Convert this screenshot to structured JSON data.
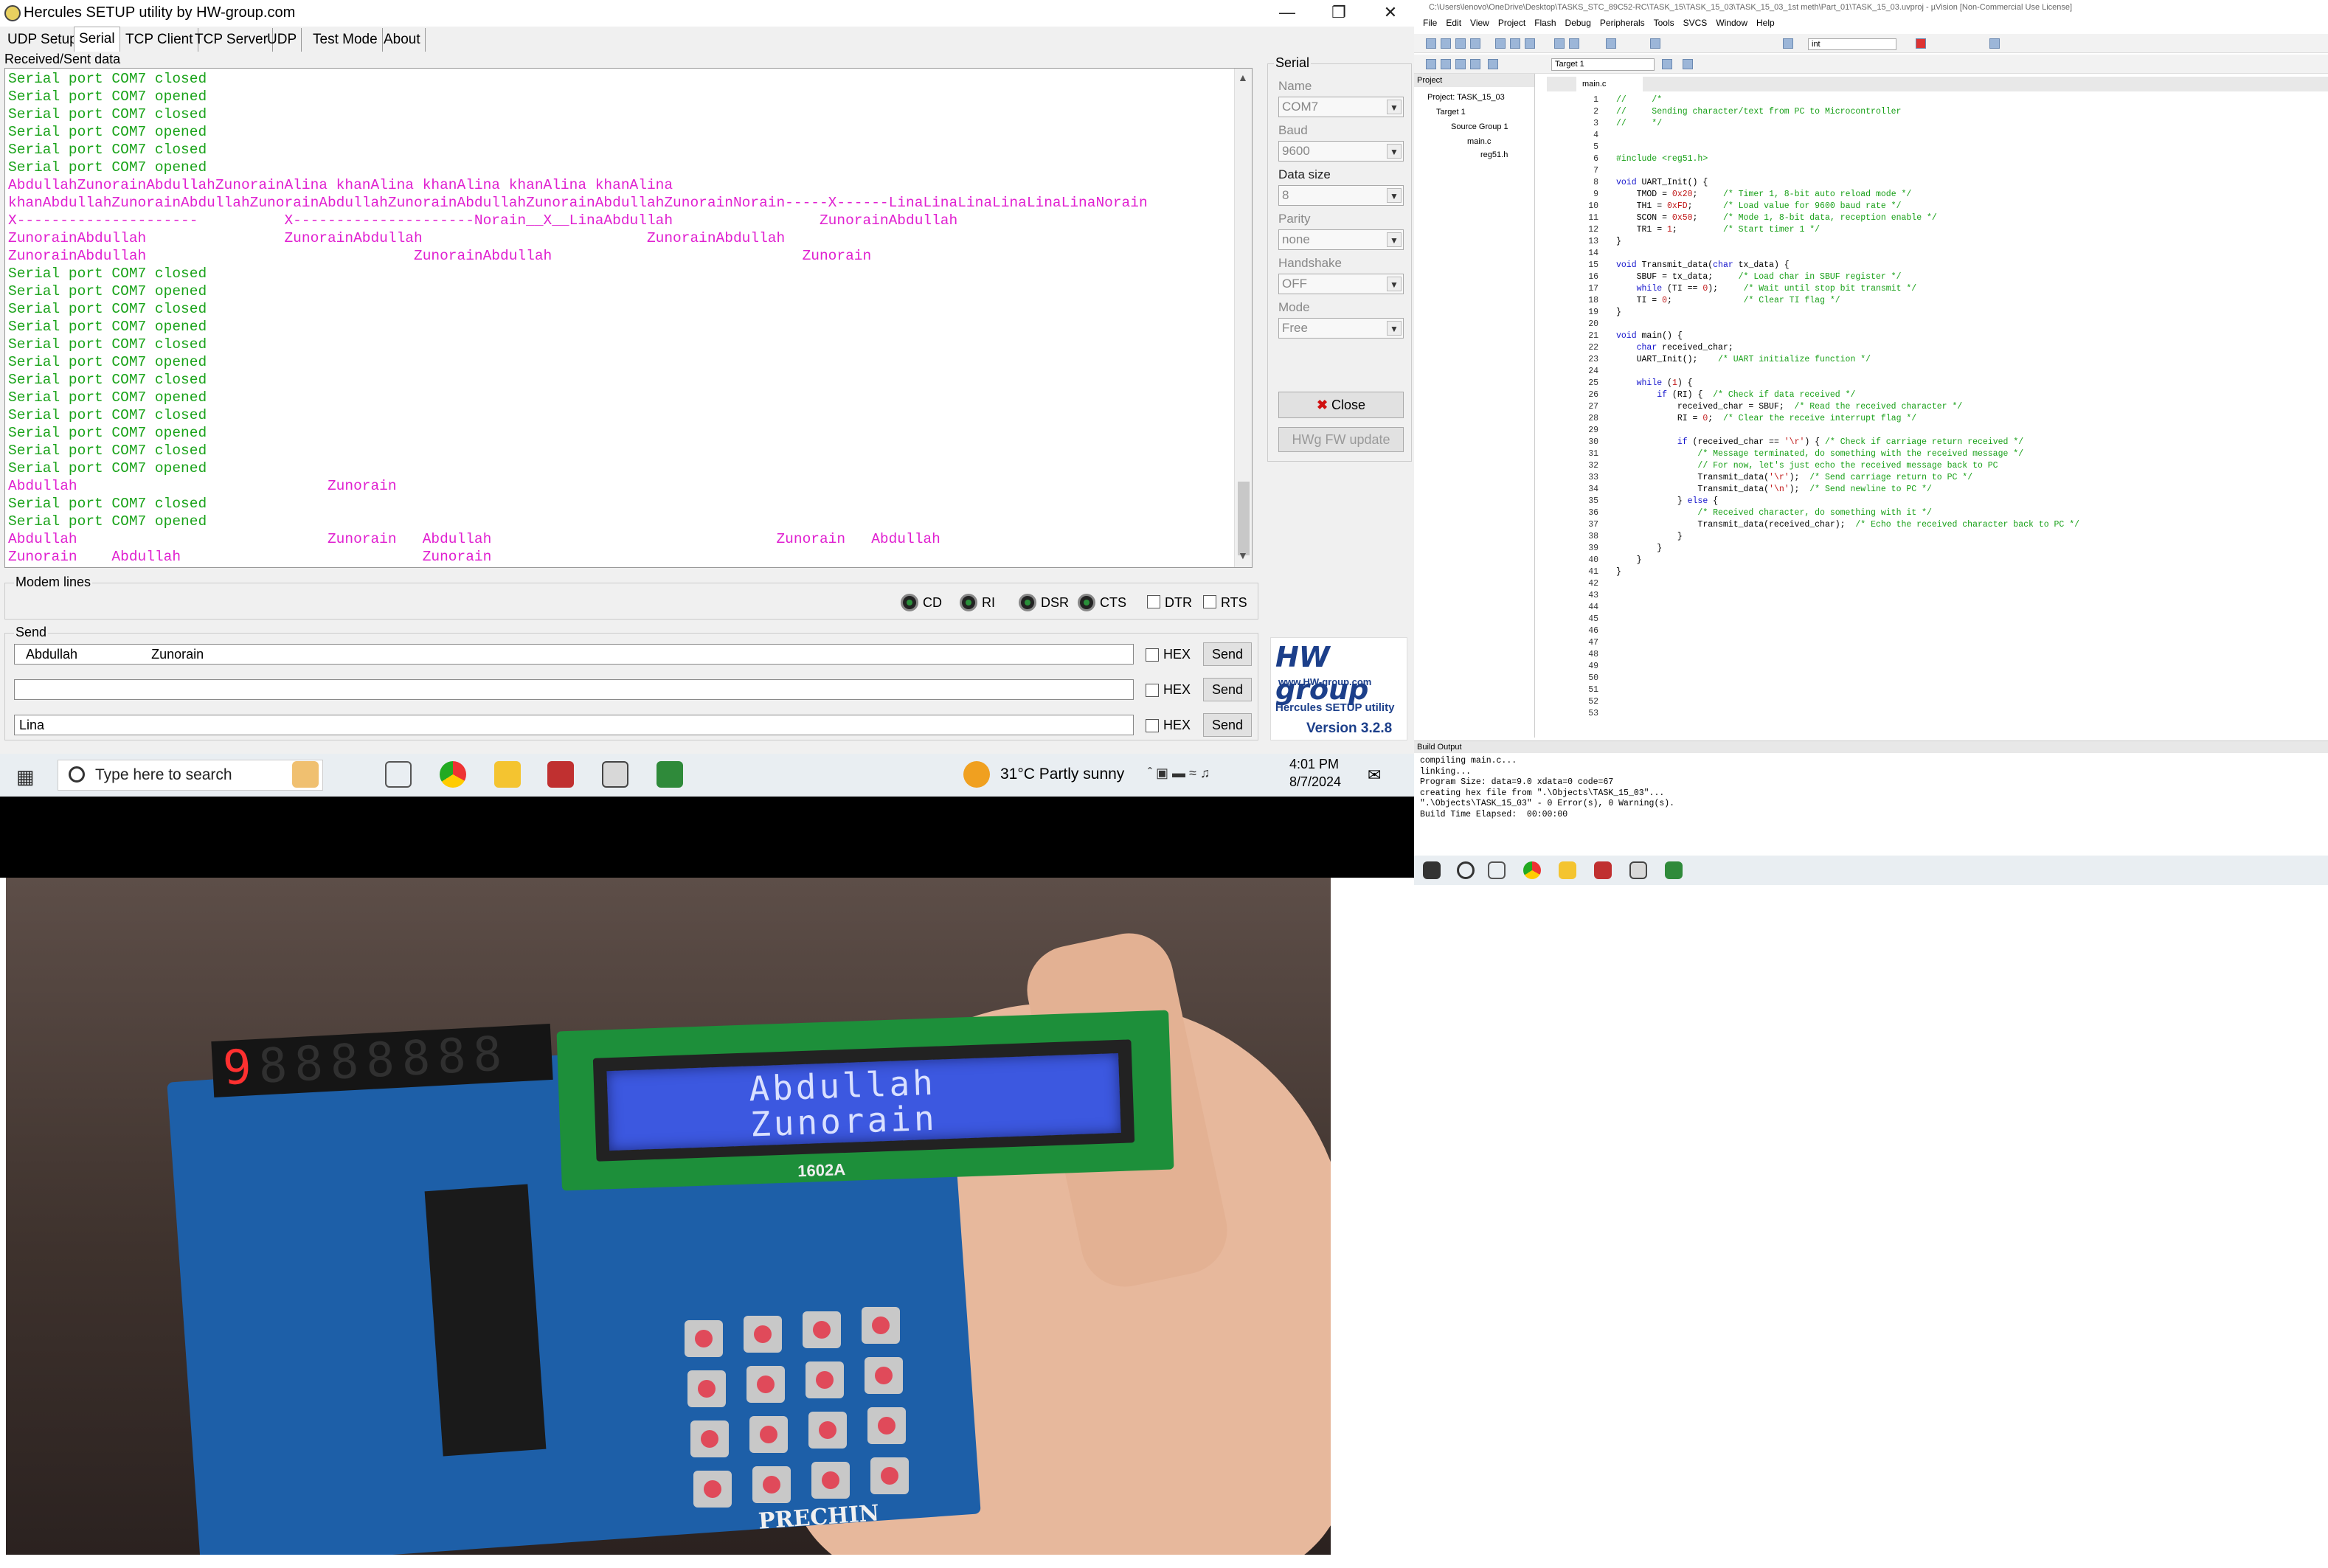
{
  "hercules": {
    "title": "Hercules SETUP utility by HW-group.com",
    "tabs": [
      "UDP Setup",
      "Serial",
      "TCP Client",
      "TCP Server",
      "UDP",
      "Test Mode",
      "About"
    ],
    "received_label": "Received/Sent data",
    "terminal": [
      {
        "t": "Serial port COM7 closed",
        "c": "g"
      },
      {
        "t": "Serial port COM7 opened",
        "c": "g"
      },
      {
        "t": "Serial port COM7 closed",
        "c": "g"
      },
      {
        "t": "Serial port COM7 opened",
        "c": "g"
      },
      {
        "t": "Serial port COM7 closed",
        "c": "g"
      },
      {
        "t": "Serial port COM7 opened",
        "c": "g"
      },
      {
        "t": "AbdullahZunorainAbdullahZunorainAlina khanAlina khanAlina khanAlina khanAlina",
        "c": "m"
      },
      {
        "t": "khanAbdullahZunorainAbdullahZunorainAbdullahZunorainAbdullahZunorainAbdullahZunorainNorain-----X------LinaLinaLinaLinaLinaLinaNorain",
        "c": "m"
      },
      {
        "t": "X---------------------          X---------------------Norain__X__LinaAbdullah                 ZunorainAbdullah",
        "c": "m"
      },
      {
        "t": "ZunorainAbdullah                ZunorainAbdullah                          ZunorainAbdullah",
        "c": "m"
      },
      {
        "t": "ZunorainAbdullah                               ZunorainAbdullah                             Zunorain",
        "c": "m"
      },
      {
        "t": "Serial port COM7 closed",
        "c": "g"
      },
      {
        "t": "Serial port COM7 opened",
        "c": "g"
      },
      {
        "t": "Serial port COM7 closed",
        "c": "g"
      },
      {
        "t": "Serial port COM7 opened",
        "c": "g"
      },
      {
        "t": "Serial port COM7 closed",
        "c": "g"
      },
      {
        "t": "Serial port COM7 opened",
        "c": "g"
      },
      {
        "t": "Serial port COM7 closed",
        "c": "g"
      },
      {
        "t": "Serial port COM7 opened",
        "c": "g"
      },
      {
        "t": "Serial port COM7 closed",
        "c": "g"
      },
      {
        "t": "Serial port COM7 opened",
        "c": "g"
      },
      {
        "t": "Serial port COM7 closed",
        "c": "g"
      },
      {
        "t": "Serial port COM7 opened",
        "c": "g"
      },
      {
        "t": "Abdullah                             Zunorain",
        "c": "m"
      },
      {
        "t": "Serial port COM7 closed",
        "c": "g"
      },
      {
        "t": "Serial port COM7 opened",
        "c": "g"
      },
      {
        "t": "Abdullah                             Zunorain   Abdullah                                 Zunorain   Abdullah",
        "c": "m"
      },
      {
        "t": "Zunorain    Abdullah                            Zunorain",
        "c": "m"
      }
    ],
    "serial_group": "Serial",
    "fields": [
      {
        "label": "Name",
        "value": "COM7"
      },
      {
        "label": "Baud",
        "value": "9600"
      },
      {
        "label": "Data size",
        "value": "8"
      },
      {
        "label": "Parity",
        "value": "none"
      },
      {
        "label": "Handshake",
        "value": "OFF"
      },
      {
        "label": "Mode",
        "value": "Free"
      }
    ],
    "close_button": "Close",
    "hwg_button": "HWg FW update",
    "modem_label": "Modem lines",
    "leds": [
      "CD",
      "RI",
      "DSR",
      "CTS"
    ],
    "checks": [
      "DTR",
      "RTS"
    ],
    "send_label": "Send",
    "send_rows": [
      {
        "value": "  Abdullah                    Zunorain",
        "hex": "HEX",
        "btn": "Send"
      },
      {
        "value": "",
        "hex": "HEX",
        "btn": "Send"
      },
      {
        "value": "Lina",
        "hex": "HEX",
        "btn": "Send"
      }
    ],
    "logo": {
      "brand": "HW group",
      "url": "www.HW-group.com",
      "product": "Hercules SETUP utility",
      "version": "Version  3.2.8"
    }
  },
  "taskbar": {
    "search_placeholder": "Type here to search",
    "weather": "31°C  Partly sunny",
    "time": "4:01 PM",
    "date": "8/7/2024"
  },
  "keil": {
    "title": "C:\\Users\\lenovo\\OneDrive\\Desktop\\TASKS_STC_89C52-RC\\TASK_15\\TASK_15_03\\TASK_15_03_1st meth\\Part_01\\TASK_15_03.uvproj - µVision  [Non-Commercial Use License]",
    "menu": [
      "File",
      "Edit",
      "View",
      "Project",
      "Flash",
      "Debug",
      "Peripherals",
      "Tools",
      "SVCS",
      "Window",
      "Help"
    ],
    "target_combo": "Target 1",
    "int_combo": "int",
    "project_header": "Project",
    "tree": [
      "Project: TASK_15_03",
      "Target 1",
      "Source Group 1",
      "main.c",
      "reg51.h"
    ],
    "editor_tab": "main.c",
    "build_header": "Build Output",
    "build_log": [
      "compiling main.c...",
      "linking...",
      "Program Size: data=9.0 xdata=0 code=67",
      "creating hex file from \".\\Objects\\TASK_15_03\"...",
      "\".\\Objects\\TASK_15_03\" - 0 Error(s), 0 Warning(s).",
      "Build Time Elapsed:  00:00:00"
    ]
  },
  "board": {
    "lcd_line1": "Abdullah",
    "lcd_line2": "Zunorain",
    "seg_display": "9.8.8.8.8.8.8.8",
    "lcd_module": "1602A",
    "brand": "PRECHIN"
  }
}
